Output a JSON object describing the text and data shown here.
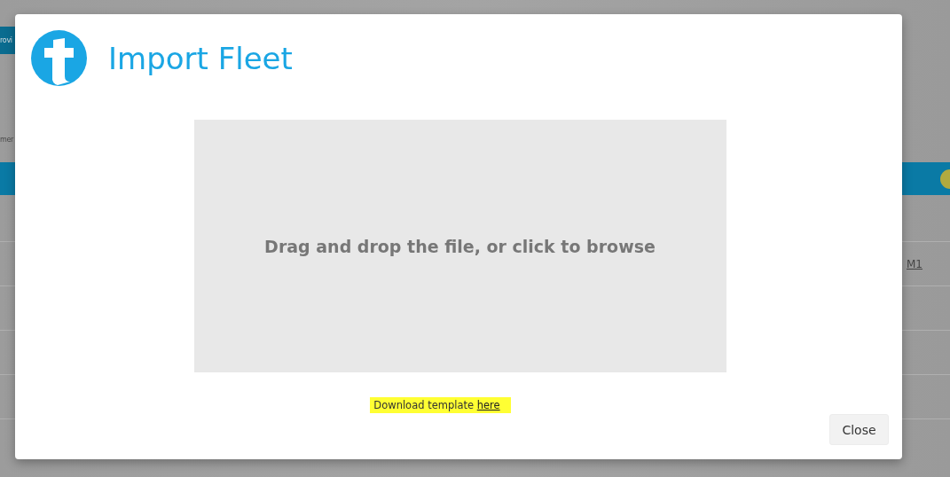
{
  "background_page": {
    "button_label": "rovi",
    "label": "mer",
    "row_link": "M1"
  },
  "dialog": {
    "title": "Import Fleet",
    "dropzone": {
      "text": "Drag and drop the file, or click to browse"
    },
    "template_note": {
      "text": "Download template ",
      "link": "here"
    },
    "buttons": [
      {
        "label": "Close"
      }
    ]
  }
}
